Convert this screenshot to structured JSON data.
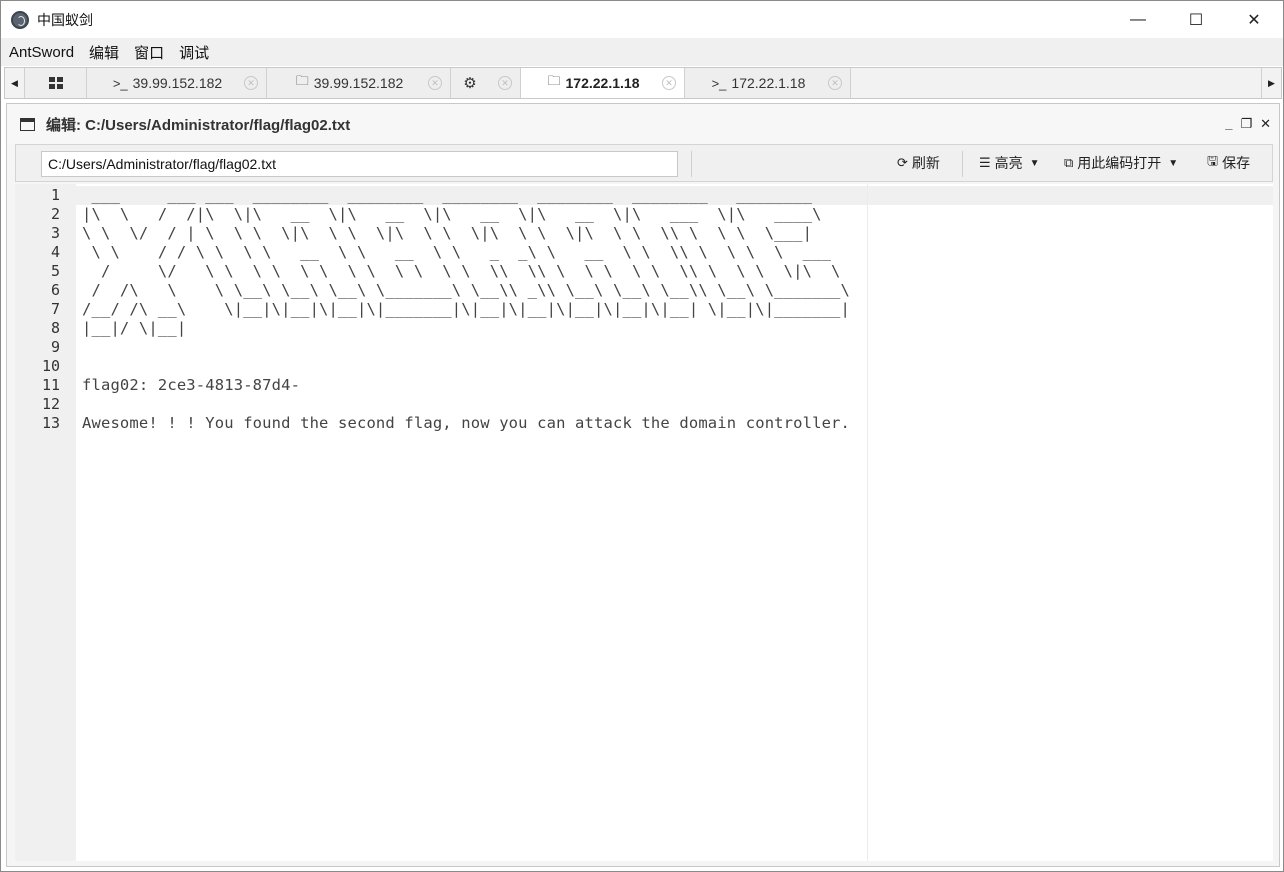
{
  "window": {
    "title": "中国蚁剑",
    "minimize": "—",
    "maximize": "☐",
    "close": "✕"
  },
  "menu": {
    "items": [
      "AntSword",
      "编辑",
      "窗口",
      "调试"
    ]
  },
  "tabs": [
    {
      "label": "39.99.152.182",
      "icon": "terminal-icon",
      "glyph": ">_",
      "active": false
    },
    {
      "label": "39.99.152.182",
      "icon": "folder-icon",
      "glyph": "🗀",
      "active": false
    },
    {
      "label": "",
      "icon": "gear-icon",
      "glyph": "⚙",
      "active": false
    },
    {
      "label": "172.22.1.18",
      "icon": "folder-icon",
      "glyph": "🗀",
      "active": true
    },
    {
      "label": "172.22.1.18",
      "icon": "terminal-icon",
      "glyph": ">_",
      "active": false
    }
  ],
  "panel": {
    "title": "编辑: C:/Users/Administrator/flag/flag02.txt"
  },
  "toolbar": {
    "path_value": "C:/Users/Administrator/flag/flag02.txt",
    "refresh_label": "刷新",
    "highlight_label": "高亮",
    "open_with_encoding_label": "用此编码打开",
    "save_label": "保存"
  },
  "editor": {
    "lines": [
      " ___     ___ ___  ________  ________  ________  ________  ________   ________",
      "|\\  \\   /  /|\\  \\|\\   __  \\|\\   __  \\|\\   __  \\|\\   __  \\|\\   ___  \\|\\   ____\\",
      "\\ \\  \\/  / | \\  \\ \\  \\|\\  \\ \\  \\|\\  \\ \\  \\|\\  \\ \\  \\|\\  \\ \\  \\\\ \\  \\ \\  \\___|",
      " \\ \\    / / \\ \\  \\ \\   __  \\ \\   __  \\ \\   _  _\\ \\   __  \\ \\  \\\\ \\  \\ \\  \\  ___",
      "  /     \\/   \\ \\  \\ \\  \\ \\  \\ \\  \\ \\  \\ \\  \\\\  \\\\ \\  \\ \\  \\ \\  \\\\ \\  \\ \\  \\|\\  \\",
      " /  /\\   \\    \\ \\__\\ \\__\\ \\__\\ \\_______\\ \\__\\\\ _\\\\ \\__\\ \\__\\ \\__\\\\ \\__\\ \\_______\\",
      "/__/ /\\ __\\    \\|__|\\|__|\\|__|\\|_______|\\|__|\\|__|\\|__|\\|__|\\|__| \\|__|\\|_______|",
      "|__|/ \\|__|",
      "",
      "",
      "flag02: 2ce3-4813-87d4-",
      "",
      "Awesome! ! ! You found the second flag, now you can attack the domain controller."
    ]
  }
}
